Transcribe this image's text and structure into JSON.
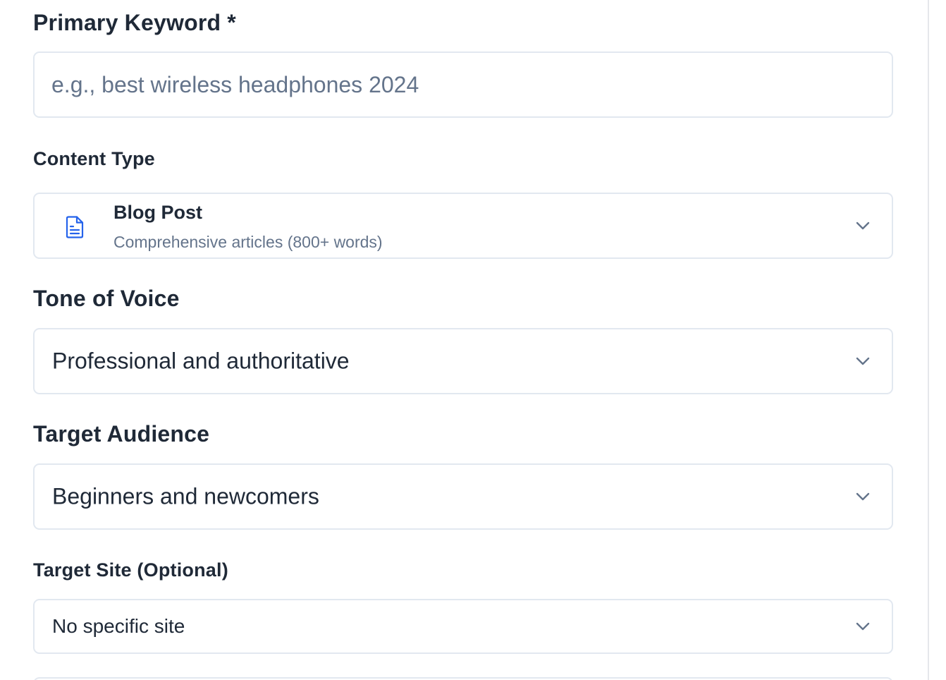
{
  "form": {
    "primary_keyword": {
      "label": "Primary Keyword *",
      "value": "",
      "placeholder": "e.g., best wireless headphones 2024"
    },
    "content_type": {
      "label": "Content Type",
      "selected_title": "Blog Post",
      "selected_description": "Comprehensive articles (800+ words)",
      "icon": "document-icon"
    },
    "tone_of_voice": {
      "label": "Tone of Voice",
      "selected": "Professional and authoritative"
    },
    "target_audience": {
      "label": "Target Audience",
      "selected": "Beginners and newcomers"
    },
    "target_site": {
      "label": "Target Site (Optional)",
      "selected": "No specific site"
    }
  },
  "colors": {
    "accent_icon": "#2563eb",
    "border": "#e2e8f0",
    "text": "#1f2937",
    "muted": "#64748b"
  }
}
